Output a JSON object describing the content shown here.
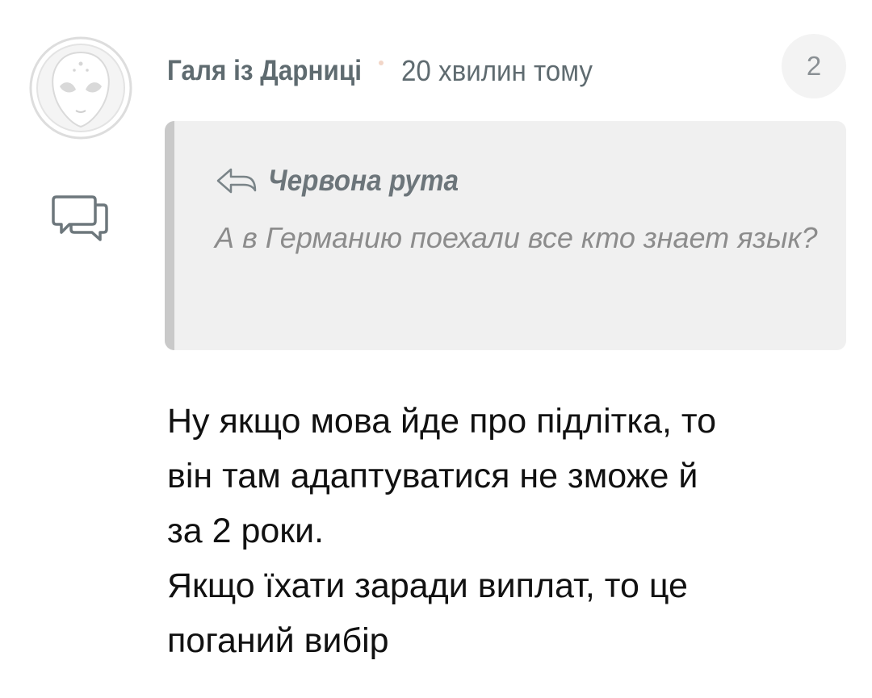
{
  "comment": {
    "author": "Галя із Дарниці",
    "time": "20 хвилин тому",
    "count": "2",
    "avatar_icon": "alien-face-icon",
    "reply_icon": "chat-bubbles-icon",
    "quote": {
      "author": "Червона рута",
      "arrow_icon": "reply-arrow-icon",
      "text": "А в Германию поехали все кто знает язык?"
    },
    "message_lines": [
      "Ну якщо мова йде про підлітка, то",
      "він там адаптуватися не зможе й",
      "за 2 роки.",
      "Якщо їхати заради виплат, то це",
      "поганий вибір"
    ]
  },
  "colors": {
    "meta_text": "#5f6b70",
    "quote_bg": "#f0f0f0",
    "quote_bar": "#c9c9c9",
    "quote_text": "#8c8c8c",
    "dot": "#f2d6c8",
    "message_text": "#111111"
  }
}
